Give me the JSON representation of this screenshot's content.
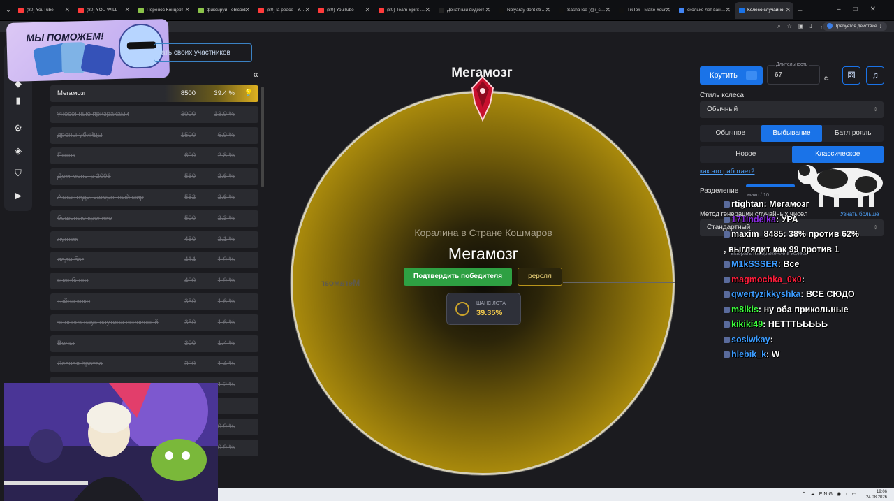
{
  "browser": {
    "tabs": [
      {
        "title": "(80) YouTube",
        "color": "#ff3b3b"
      },
      {
        "title": "(80) YOU WILL",
        "color": "#ff3b3b"
      },
      {
        "title": "Перенос Концерт",
        "color": "#8bc34a"
      },
      {
        "title": "фиксируй - eblcoid",
        "color": "#8bc34a"
      },
      {
        "title": "(80) la peace - YouT",
        "color": "#ff3b3b"
      },
      {
        "title": "(80) YouTube",
        "color": "#ff3b3b"
      },
      {
        "title": "(80) Team Spirit - Yo",
        "color": "#ff3b3b"
      },
      {
        "title": "Донатный виджет",
        "color": "#222"
      },
      {
        "title": "Nolyaray dont strea",
        "color": "#111"
      },
      {
        "title": "Sasha Ice (@i_sashu",
        "color": "#111"
      },
      {
        "title": "TikTok - Make Your",
        "color": "#111"
      },
      {
        "title": "сколько лет ване р",
        "color": "#4285f4"
      },
      {
        "title": "Колесо случайно",
        "color": "#1a73e8"
      }
    ],
    "action_required": "Требуется действие"
  },
  "promo": {
    "text": "МЫ ПОМОЖЕМ!"
  },
  "sidebar": {
    "add_participants": "ать своих участников"
  },
  "lots": [
    {
      "name": "Мегамозг",
      "amount": "8500",
      "percent": "39.4 %"
    },
    {
      "name": "унесенные призраками",
      "amount": "3000",
      "percent": "13.9 %"
    },
    {
      "name": "дроны-убийцы",
      "amount": "1500",
      "percent": "6.9 %"
    },
    {
      "name": "Поток",
      "amount": "600",
      "percent": "2.8 %"
    },
    {
      "name": "Дом-монстр 2006",
      "amount": "560",
      "percent": "2.6 %"
    },
    {
      "name": "Атлантидо: затерянный мир",
      "amount": "552",
      "percent": "2.6 %"
    },
    {
      "name": "бешеные кролико",
      "amount": "500",
      "percent": "2.3 %"
    },
    {
      "name": "лунтик",
      "amount": "450",
      "percent": "2.1 %"
    },
    {
      "name": "леди баг",
      "amount": "414",
      "percent": "1.9 %"
    },
    {
      "name": "колобанга",
      "amount": "400",
      "percent": "1.9 %"
    },
    {
      "name": "тайна коко",
      "amount": "350",
      "percent": "1.6 %"
    },
    {
      "name": "человек паук-паутина вселенной",
      "amount": "350",
      "percent": "1.6 %"
    },
    {
      "name": "Вольт",
      "amount": "300",
      "percent": "1.4 %"
    },
    {
      "name": "Лесная братва",
      "amount": "300",
      "percent": "1.4 %"
    },
    {
      "name": "",
      "amount": "",
      "percent": "1.2 %"
    },
    {
      "name": "",
      "amount": "",
      "percent": ""
    },
    {
      "name": "",
      "amount": "",
      "percent": "0.9 %"
    },
    {
      "name": "",
      "amount": "",
      "percent": "0.9 %"
    }
  ],
  "wheel": {
    "title": "Мегамозг",
    "mirrored_label": "Мегамозг",
    "previous": "Коралина в Стране Кошмаров",
    "winner": "Мегамозг",
    "confirm": "Подтвердить победителя",
    "reroll": "реролл",
    "chance_label": "ШАНС ЛОТА",
    "chance_value": "39.35%",
    "fill_color": "#b8960f"
  },
  "settings": {
    "spin": "Крутить",
    "duration_label": "Длительность",
    "duration_value": "67",
    "duration_unit": "с.",
    "style_label": "Стиль колеса",
    "style_value": "Обычный",
    "modes": [
      "Обычное",
      "Выбывание",
      "Батл рояль"
    ],
    "submodes": [
      "Новое",
      "Классическое"
    ],
    "how_link": "как это работает?",
    "split_label": "Разделение",
    "split_hint": "макс / 10",
    "rng_label": "Метод генерации случайных чисел",
    "learn_more": "Узнать больше",
    "rng_value": "Стандартный",
    "extra_hint": "Выбрать изображение в колесе",
    "accent": "#1a73e8"
  },
  "chat": [
    {
      "user": "rtightan",
      "color": "#ffffff",
      "text": "Мегамозг"
    },
    {
      "user": "171indeika",
      "color": "#8a2be2",
      "text": "УРА"
    },
    {
      "user": "maxim_8485",
      "color": "#ffffff",
      "text": "38% против 62%"
    },
    {
      "user": "",
      "color": "#ffffff",
      "text": ", выглядит как 99 против 1"
    },
    {
      "user": "M1kSSSER",
      "color": "#3c9cff",
      "text": "Все"
    },
    {
      "user": "magmochka_0x0",
      "color": "#ff1e3c",
      "text": ""
    },
    {
      "user": "qwertyzikkyshka",
      "color": "#3c9cff",
      "text": "ВСЕ СЮДО"
    },
    {
      "user": "m8lkis",
      "color": "#3cff3c",
      "text": "ну оба прикольные"
    },
    {
      "user": "kikiki49",
      "color": "#3cff3c",
      "text": "НЕТТТЬЬЬЬЬ"
    },
    {
      "user": "sosiwkay",
      "color": "#3c9cff",
      "text": ""
    },
    {
      "user": "hlebik_k",
      "color": "#3c9cff",
      "text": "W"
    }
  ],
  "taskbar": {
    "lang": "ENG",
    "time": "19:06",
    "date": "24.08.2026"
  }
}
